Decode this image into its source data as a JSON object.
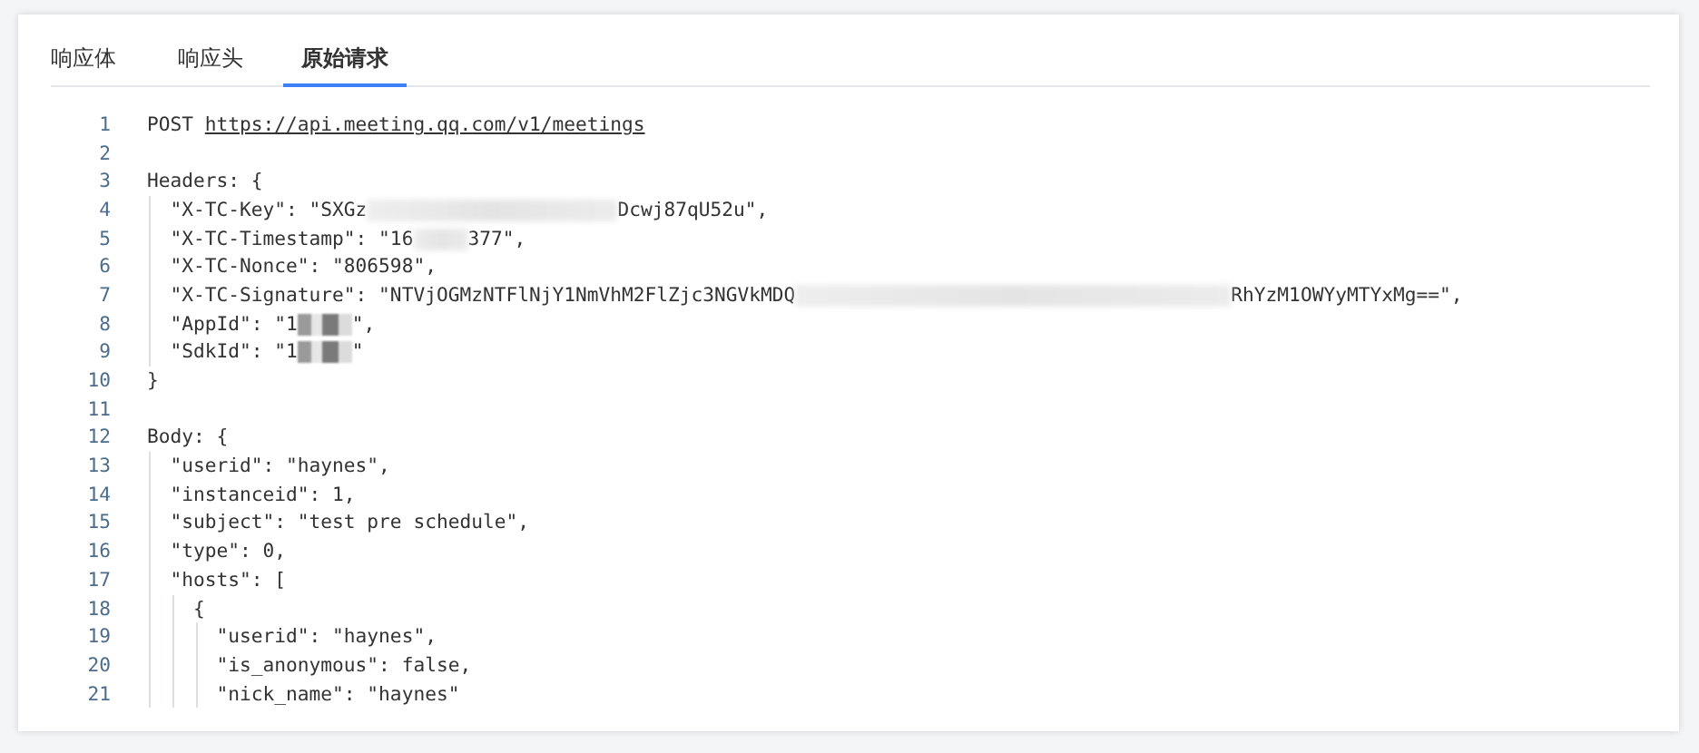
{
  "tabs": [
    {
      "label": "响应体",
      "selected": false
    },
    {
      "label": "响应头",
      "selected": false
    },
    {
      "label": "原始请求",
      "selected": true
    }
  ],
  "code": {
    "lines": [
      {
        "number": "1",
        "parts": [
          {
            "kind": "text",
            "text": "POST "
          },
          {
            "kind": "link",
            "text": "https://api.meeting.qq.com/v1/meetings"
          }
        ]
      },
      {
        "number": "2"
      },
      {
        "number": "3",
        "parts": [
          {
            "kind": "text",
            "text": "Headers: {"
          }
        ]
      },
      {
        "number": "4",
        "parts": [
          {
            "kind": "text",
            "text": "  \"X-TC-Key\": \"SXGz"
          },
          {
            "kind": "blur"
          },
          {
            "kind": "text",
            "text": "Dcwj87qU52u\","
          }
        ]
      },
      {
        "number": "5",
        "parts": [
          {
            "kind": "text",
            "text": "  \"X-TC-Timestamp\": \"16"
          },
          {
            "kind": "blurshort"
          },
          {
            "kind": "text",
            "text": "377\","
          }
        ]
      },
      {
        "number": "6",
        "parts": [
          {
            "kind": "text",
            "text": "  \"X-TC-Nonce\": \"806598\","
          }
        ]
      },
      {
        "number": "7",
        "parts": [
          {
            "kind": "text",
            "text": "  \"X-TC-Signature\": \"NTVjOGMzNTFlNjY1NmVhM2FlZjc3NGVkMDQ"
          },
          {
            "kind": "blurlong"
          },
          {
            "kind": "text",
            "text": "RhYzM1OWYyMTYxMg==\","
          }
        ]
      },
      {
        "number": "8",
        "parts": [
          {
            "kind": "text",
            "text": "  \"AppId\": \"1"
          },
          {
            "kind": "pixel"
          },
          {
            "kind": "text",
            "text": "\","
          }
        ]
      },
      {
        "number": "9",
        "parts": [
          {
            "kind": "text",
            "text": "  \"SdkId\": \"1"
          },
          {
            "kind": "pixel"
          },
          {
            "kind": "text",
            "text": "\""
          }
        ]
      },
      {
        "number": "10",
        "parts": [
          {
            "kind": "text",
            "text": "}"
          }
        ]
      },
      {
        "number": "11"
      },
      {
        "number": "12",
        "parts": [
          {
            "kind": "text",
            "text": "Body: {"
          }
        ]
      },
      {
        "number": "13",
        "parts": [
          {
            "kind": "text",
            "text": "  \"userid\": \"haynes\","
          }
        ]
      },
      {
        "number": "14",
        "parts": [
          {
            "kind": "text",
            "text": "  \"instanceid\": 1,"
          }
        ]
      },
      {
        "number": "15",
        "parts": [
          {
            "kind": "text",
            "text": "  \"subject\": \"test pre schedule\","
          }
        ]
      },
      {
        "number": "16",
        "parts": [
          {
            "kind": "text",
            "text": "  \"type\": 0,"
          }
        ]
      },
      {
        "number": "17",
        "parts": [
          {
            "kind": "text",
            "text": "  \"hosts\": ["
          }
        ]
      },
      {
        "number": "18",
        "parts": [
          {
            "kind": "text",
            "text": "    {"
          }
        ]
      },
      {
        "number": "19",
        "parts": [
          {
            "kind": "text",
            "text": "      \"userid\": \"haynes\","
          }
        ]
      },
      {
        "number": "20",
        "parts": [
          {
            "kind": "text",
            "text": "      \"is_anonymous\": false,"
          }
        ]
      },
      {
        "number": "21",
        "parts": [
          {
            "kind": "text",
            "text": "      \"nick_name\": \"haynes\""
          }
        ]
      }
    ]
  }
}
